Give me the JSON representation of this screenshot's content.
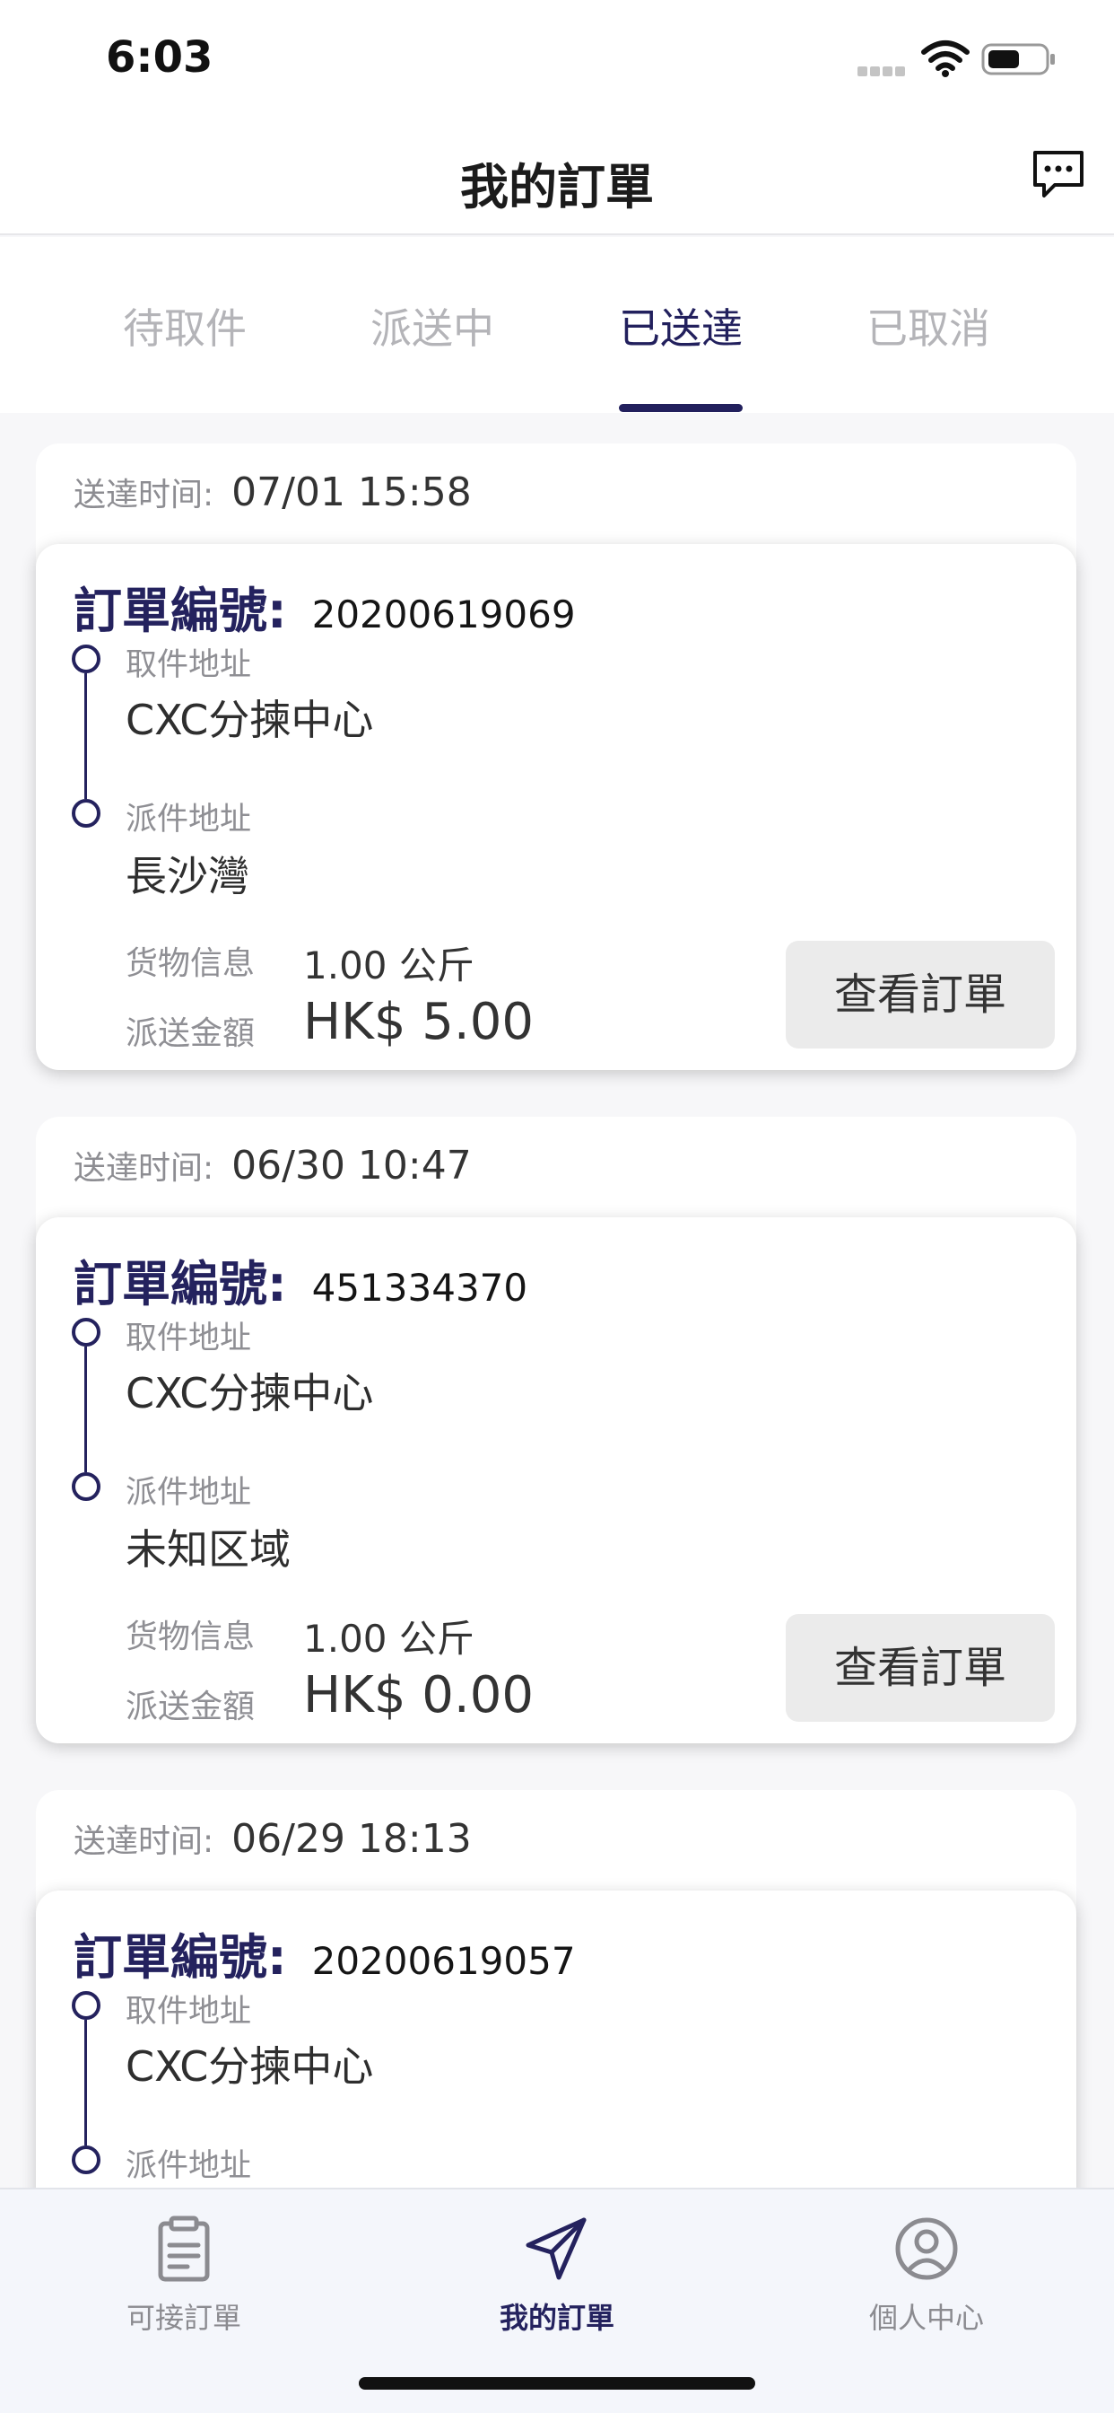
{
  "status_bar": {
    "time": "6:03"
  },
  "header": {
    "title": "我的訂單",
    "chat_icon": "chat-bubble-icon"
  },
  "tabs": [
    {
      "label": "待取件",
      "active": false
    },
    {
      "label": "派送中",
      "active": false
    },
    {
      "label": "已送達",
      "active": true
    },
    {
      "label": "已取消",
      "active": false
    }
  ],
  "labels": {
    "delivered_time": "送達时间:",
    "order_no": "訂單編號:",
    "pickup_address": "取件地址",
    "delivery_address": "派件地址",
    "cargo_info": "货物信息",
    "delivery_fee": "派送金額",
    "view_order": "查看訂單"
  },
  "orders": [
    {
      "delivered_time": "07/01 15:58",
      "order_no": "20200619069",
      "pickup_address": "CXC分揀中心",
      "delivery_address": "長沙灣",
      "weight": "1.00 公斤",
      "fee": "HK$ 5.00"
    },
    {
      "delivered_time": "06/30 10:47",
      "order_no": "451334370",
      "pickup_address": "CXC分揀中心",
      "delivery_address": "未知区域",
      "weight": "1.00 公斤",
      "fee": "HK$ 0.00"
    },
    {
      "delivered_time": "06/29 18:13",
      "order_no": "20200619057",
      "pickup_address": "CXC分揀中心",
      "delivery_address": "",
      "weight": "",
      "fee": ""
    }
  ],
  "tab_bar": [
    {
      "label": "可接訂單",
      "icon": "clipboard-icon",
      "active": false
    },
    {
      "label": "我的訂單",
      "icon": "paper-plane-icon",
      "active": true
    },
    {
      "label": "個人中心",
      "icon": "user-circle-icon",
      "active": false
    }
  ],
  "colors": {
    "accent": "#24225e",
    "inactive_tab": "#b4b4b8",
    "muted_text": "#8f8f94",
    "button_bg": "#ebebeb"
  }
}
